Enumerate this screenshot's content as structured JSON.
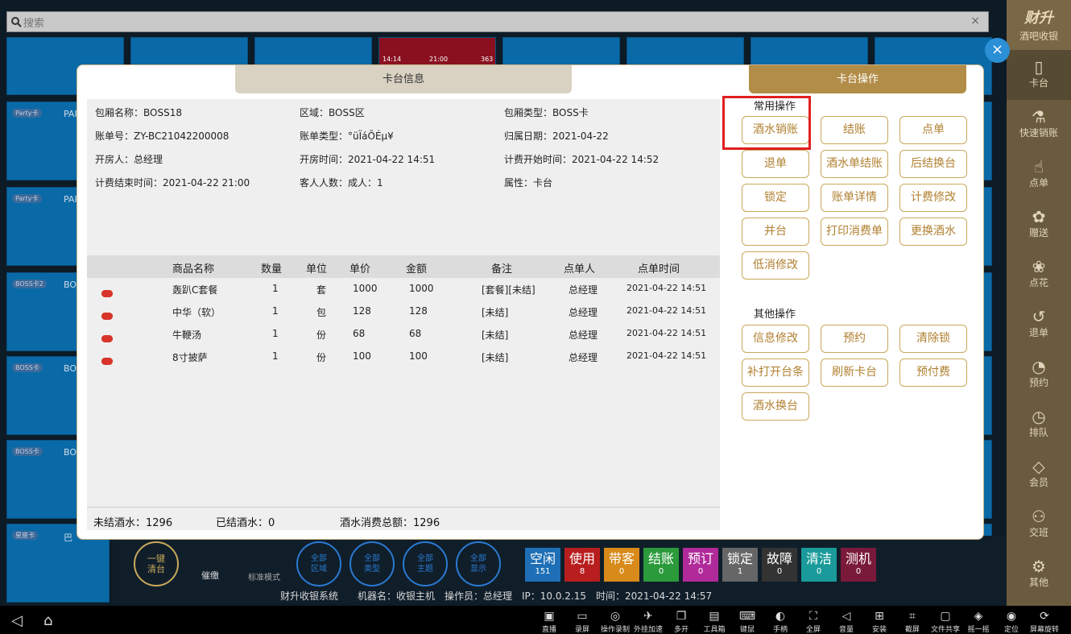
{
  "search": {
    "placeholder": "搜索",
    "clear": "×"
  },
  "tiles": {
    "labels": [
      "Party卡",
      "Party卡",
      "BOSS卡2",
      "BOSS卡",
      "BOSS卡",
      "星座卡"
    ],
    "names": [
      "PAR",
      "PAR",
      "BO",
      "BO",
      "BO",
      "巴"
    ],
    "red_times": [
      "14:14",
      "21:00",
      "363"
    ]
  },
  "brand": {
    "name": "财升",
    "sub": "酒吧收银"
  },
  "sidebar": [
    {
      "label": "卡台",
      "icon": "▯"
    },
    {
      "label": "快速销账",
      "icon": "⚗"
    },
    {
      "label": "点单",
      "icon": "☝"
    },
    {
      "label": "赠送",
      "icon": "✿"
    },
    {
      "label": "点花",
      "icon": "❀"
    },
    {
      "label": "退单",
      "icon": "↺"
    },
    {
      "label": "预约",
      "icon": "◔"
    },
    {
      "label": "排队",
      "icon": "◷"
    },
    {
      "label": "会员",
      "icon": "◇"
    },
    {
      "label": "交班",
      "icon": "⚇"
    },
    {
      "label": "其他",
      "icon": "⚙"
    }
  ],
  "modal": {
    "tab_info": "卡台信息",
    "tab_ops": "卡台操作",
    "info": [
      {
        "k": "包厢名称：",
        "v": "BOSS18"
      },
      {
        "k": "区域：",
        "v": "BOSS区"
      },
      {
        "k": "包厢类型：",
        "v": "BOSS卡"
      },
      {
        "k": "账单号：",
        "v": "ZY-BC21042200008"
      },
      {
        "k": "账单类型：",
        "v": "°üÏáÕÉµ¥"
      },
      {
        "k": "归属日期：",
        "v": "2021-04-22"
      },
      {
        "k": "开房人：",
        "v": "总经理"
      },
      {
        "k": "开房时间：",
        "v": "2021-04-22 14:51"
      },
      {
        "k": "计费开始时间：",
        "v": "2021-04-22 14:52"
      },
      {
        "k": "计费结束时间：",
        "v": "2021-04-22 21:00"
      },
      {
        "k": "客人人数：",
        "v": "成人：1"
      },
      {
        "k": "属性：",
        "v": "卡台"
      }
    ],
    "headers": [
      "商品名称",
      "数量",
      "单位",
      "单价",
      "金额",
      "备注",
      "点单人",
      "点单时间"
    ],
    "rows": [
      [
        "轰趴C套餐",
        "1",
        "套",
        "1000",
        "1000",
        "[套餐][未结]",
        "总经理",
        "2021-04-22 14:51"
      ],
      [
        "中华（软）",
        "1",
        "包",
        "128",
        "128",
        "[未结]",
        "总经理",
        "2021-04-22 14:51"
      ],
      [
        "牛鞭汤",
        "1",
        "份",
        "68",
        "68",
        "[未结]",
        "总经理",
        "2021-04-22 14:51"
      ],
      [
        "8寸披萨",
        "1",
        "份",
        "100",
        "100",
        "[未结]",
        "总经理",
        "2021-04-22 14:51"
      ]
    ],
    "footer": {
      "unsettled": "未结酒水：1296",
      "settled": "已结酒水：0",
      "total": "酒水消费总额：1296"
    },
    "common_title": "常用操作",
    "common": [
      "酒水销账",
      "结账",
      "点单",
      "退单",
      "酒水单结账",
      "后结换台",
      "锁定",
      "账单详情",
      "计费修改",
      "并台",
      "打印消费单",
      "更换酒水",
      "低消修改"
    ],
    "other_title": "其他操作",
    "other": [
      "信息修改",
      "预约",
      "清除锁",
      "补打开台条",
      "刷新卡台",
      "预付费",
      "酒水换台"
    ]
  },
  "lower": {
    "circles": [
      "一键\n清台",
      "全部\n区域",
      "全部\n类型",
      "全部\n主题",
      "全部\n显示"
    ],
    "cuijiao": "催缴",
    "mode": "标准模式",
    "status": [
      {
        "l": "空闲",
        "c": "151",
        "color": "#1e6fb5"
      },
      {
        "l": "使用",
        "c": "8",
        "color": "#b81e1e"
      },
      {
        "l": "带客",
        "c": "0",
        "color": "#d88a1a"
      },
      {
        "l": "结账",
        "c": "0",
        "color": "#2a9a3a"
      },
      {
        "l": "预订",
        "c": "0",
        "color": "#b02a9a"
      },
      {
        "l": "锁定",
        "c": "1",
        "color": "#666666"
      },
      {
        "l": "故障",
        "c": "0",
        "color": "#333333"
      },
      {
        "l": "清洁",
        "c": "0",
        "color": "#1a9a9a"
      },
      {
        "l": "测机",
        "c": "0",
        "color": "#7a1a3a"
      }
    ],
    "infoline": "财升收银系统　　机器名：收银主机　操作员：总经理　IP：10.0.2.15　时间：2021-04-22 14:57"
  },
  "taskbar": [
    {
      "l": "直播",
      "i": "▣"
    },
    {
      "l": "录屏",
      "i": "▭"
    },
    {
      "l": "操作录制",
      "i": "◎"
    },
    {
      "l": "外挂加速",
      "i": "✈"
    },
    {
      "l": "多开",
      "i": "❐"
    },
    {
      "l": "工具箱",
      "i": "▤"
    },
    {
      "l": "键鼠",
      "i": "⌨"
    },
    {
      "l": "手柄",
      "i": "◐"
    },
    {
      "l": "全屏",
      "i": "⛶"
    },
    {
      "l": "音量",
      "i": "◁"
    },
    {
      "l": "安装",
      "i": "⊞"
    },
    {
      "l": "截屏",
      "i": "⌗"
    },
    {
      "l": "文件共享",
      "i": "▢"
    },
    {
      "l": "摇一摇",
      "i": "◈"
    },
    {
      "l": "定位",
      "i": "◉"
    },
    {
      "l": "屏幕旋转",
      "i": "⟳"
    }
  ]
}
